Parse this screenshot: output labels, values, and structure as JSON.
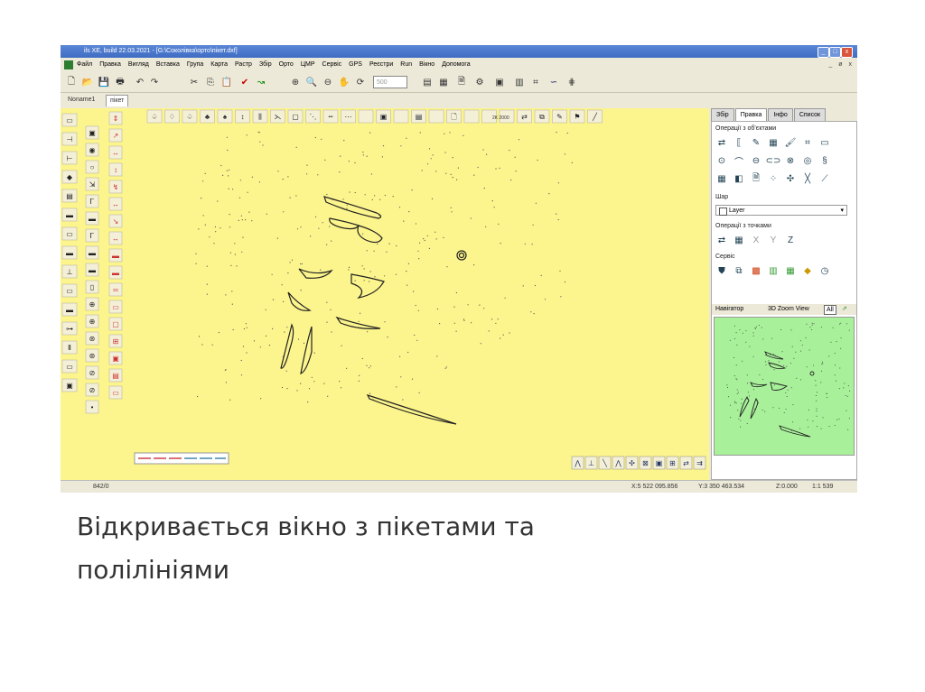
{
  "window": {
    "title": "ils XE, build 22.03.2021 - [G:\\Соколівка\\орто\\пікет.dxf]",
    "controls": [
      "_",
      "□",
      "x"
    ]
  },
  "menu": {
    "items": [
      "Файл",
      "Правка",
      "Вигляд",
      "Вставка",
      "Група",
      "Карта",
      "Растр",
      "Збір",
      "Орто",
      "ЦМР",
      "Сервіс",
      "GPS",
      "Реєстри",
      "Run",
      "Вікно",
      "Допомога"
    ],
    "mdi_controls": [
      "_",
      "ø",
      "x"
    ]
  },
  "toolbar": {
    "zoom_value": "500",
    "icons": [
      "new-icon",
      "open-icon",
      "save-icon",
      "print-icon",
      "cut-icon",
      "copy-icon",
      "paste-icon",
      "check-icon",
      "redo-arrow-icon",
      "zoom-window-icon",
      "zoom-in-icon",
      "zoom-out-icon",
      "pan-hand-icon",
      "refresh-icon",
      "layers-icon",
      "table-icon",
      "report-icon",
      "settings-icon",
      "palette-icon",
      "map-icon",
      "wave-icon",
      "grid-icon"
    ]
  },
  "document_tabs": [
    "Noname1",
    "пікет"
  ],
  "right_panel": {
    "tabs": [
      "Збір",
      "Правка",
      "Інфо",
      "Список"
    ],
    "active_tab": "Правка",
    "sections": {
      "objects": "Операції з об'єктами",
      "layer_group": "Шар",
      "layer_value": "Layer",
      "points": "Операції з точками",
      "points_labels": [
        "X",
        "Y",
        "Z"
      ],
      "service": "Сервіс"
    },
    "navigator": {
      "label": "Навігатор",
      "view": "3D Zoom View",
      "badge": "All"
    }
  },
  "statusbar": {
    "count": "842/0",
    "x": "X:5 522 095.856",
    "y": "Y:3 350 463.534",
    "z": "Z:0.000",
    "scale": "1:1 539"
  },
  "canvas_toolbar_label": "2K 2000",
  "caption": {
    "line1": "Відкривається вікно з пікетами та",
    "line2": "полілініями"
  },
  "colors": {
    "canvas": "#fcf48c",
    "navigator": "#a8f09a",
    "titlebar": "#3e6cc4"
  }
}
